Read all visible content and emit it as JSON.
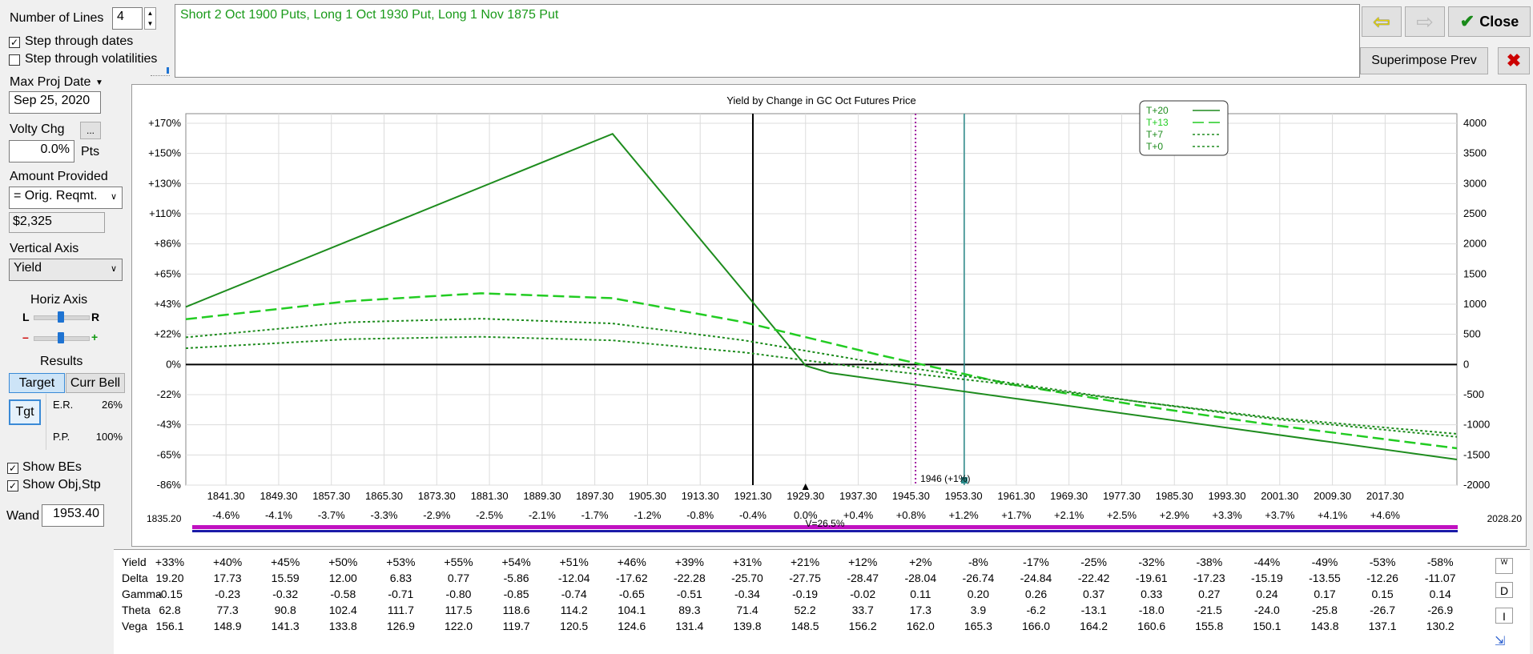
{
  "controls": {
    "lines_label": "Number of Lines",
    "lines_value": "4",
    "step_dates_label": "Step through dates",
    "step_dates_checked": true,
    "step_vols_label": "Step through volatilities",
    "step_vols_checked": false,
    "max_proj_label": "Max Proj Date",
    "max_proj_value": "Sep 25, 2020",
    "volty_label": "Volty Chg",
    "volty_btn": "...",
    "volty_value": "0.0%",
    "volty_unit": "Pts",
    "amount_label": "Amount Provided",
    "amount_select": "= Orig. Reqmt.",
    "amount_value": "$2,325",
    "vaxis_label": "Vertical Axis",
    "vaxis_select": "Yield",
    "haxis_label": "Horiz Axis",
    "haxis_l": "L",
    "haxis_r": "R",
    "haxis_minus": "–",
    "haxis_plus": "+",
    "results_label": "Results",
    "target_tab": "Target",
    "currbell_tab": "Curr Bell",
    "tgt_btn": "Tgt",
    "er_label": "E.R.",
    "er_value": "26%",
    "pp_label": "P.P.",
    "pp_value": "100%",
    "show_bes_label": "Show BEs",
    "show_bes_checked": true,
    "show_obj_label": "Show Obj,Stp",
    "show_obj_checked": true,
    "wand_label": "Wand",
    "wand_value": "1953.40"
  },
  "description": "Short 2 Oct 1900 Puts, Long 1 Oct 1930 Put, Long 1 Nov 1875 Put",
  "top_buttons": {
    "close": "Close",
    "superimpose": "Superimpose Prev"
  },
  "chart_data": {
    "type": "line",
    "title": "Yield by Change in GC Oct Futures Price",
    "x_ticks": [
      "1841.30",
      "1849.30",
      "1857.30",
      "1865.30",
      "1873.30",
      "1881.30",
      "1889.30",
      "1897.30",
      "1905.30",
      "1913.30",
      "1921.30",
      "1929.30",
      "1937.30",
      "1945.30",
      "1953.30",
      "1961.30",
      "1969.30",
      "1977.30",
      "1985.30",
      "1993.30",
      "2001.30",
      "2009.30",
      "2017.30"
    ],
    "x_pct_ticks": [
      "-4.6%",
      "-4.1%",
      "-3.7%",
      "-3.3%",
      "-2.9%",
      "-2.5%",
      "-2.1%",
      "-1.7%",
      "-1.2%",
      "-0.8%",
      "-0.4%",
      "0.0%",
      "+0.4%",
      "+0.8%",
      "+1.2%",
      "+1.7%",
      "+2.1%",
      "+2.5%",
      "+2.9%",
      "+3.3%",
      "+3.7%",
      "+4.1%",
      "+4.6%"
    ],
    "left_axis_ticks": [
      "+170%",
      "+150%",
      "+130%",
      "+110%",
      "+86%",
      "+65%",
      "+43%",
      "+22%",
      "0%",
      "-22%",
      "-43%",
      "-65%",
      "-86%"
    ],
    "right_axis_ticks": [
      "4000",
      "3500",
      "3000",
      "2500",
      "2000",
      "1500",
      "1000",
      "500",
      "0",
      "-500",
      "-1000",
      "-1500",
      "-2000"
    ],
    "x_range": [
      1835.2,
      2028.2
    ],
    "x_min_label": "1835.20",
    "x_max_label": "2028.20",
    "y_range": [
      -2000,
      4000
    ],
    "volatility_label": "V=26.5%",
    "current_price": 1929.3,
    "wand_price": 1953.4,
    "be_line_price": 1946,
    "be_annotation": "1946 (+1%)",
    "legend_position": "top-right",
    "series": [
      {
        "name": "T+20",
        "style": "solid",
        "color": "#1e8c1e",
        "x": [
          1835.2,
          1900,
          1929.3,
          1933,
          2028.2
        ],
        "y": [
          955,
          3825,
          -20,
          -140,
          -1575
        ]
      },
      {
        "name": "T+13",
        "style": "longdash",
        "color": "#22cc22",
        "x": [
          1835.2,
          1860,
          1880,
          1900,
          1920,
          1940,
          1960,
          1980,
          2000,
          2028.2
        ],
        "y": [
          750,
          1050,
          1180,
          1100,
          700,
          170,
          -320,
          -680,
          -1000,
          -1390
        ]
      },
      {
        "name": "T+7",
        "style": "dotted",
        "color": "#1e8c1e",
        "x": [
          1835.2,
          1860,
          1880,
          1900,
          1920,
          1940,
          1960,
          1980,
          2000,
          2028.2
        ],
        "y": [
          450,
          700,
          760,
          680,
          400,
          30,
          -300,
          -620,
          -900,
          -1200
        ]
      },
      {
        "name": "T+0",
        "style": "dotted",
        "color": "#1e8c1e",
        "x": [
          1835.2,
          1860,
          1880,
          1900,
          1920,
          1940,
          1960,
          1980,
          2000,
          2028.2
        ],
        "y": [
          270,
          420,
          460,
          400,
          200,
          -80,
          -330,
          -620,
          -880,
          -1150
        ]
      }
    ]
  },
  "table": {
    "row_labels": [
      "Yield",
      "Delta",
      "Gamma",
      "Theta",
      "Vega"
    ],
    "columns": [
      [
        "+33%",
        "19.20",
        "-0.15",
        "62.8",
        "156.1"
      ],
      [
        "+40%",
        "17.73",
        "-0.23",
        "77.3",
        "148.9"
      ],
      [
        "+45%",
        "15.59",
        "-0.32",
        "90.8",
        "141.3"
      ],
      [
        "+50%",
        "12.00",
        "-0.58",
        "102.4",
        "133.8"
      ],
      [
        "+53%",
        "6.83",
        "-0.71",
        "111.7",
        "126.9"
      ],
      [
        "+55%",
        "0.77",
        "-0.80",
        "117.5",
        "122.0"
      ],
      [
        "+54%",
        "-5.86",
        "-0.85",
        "118.6",
        "119.7"
      ],
      [
        "+51%",
        "-12.04",
        "-0.74",
        "114.2",
        "120.5"
      ],
      [
        "+46%",
        "-17.62",
        "-0.65",
        "104.1",
        "124.6"
      ],
      [
        "+39%",
        "-22.28",
        "-0.51",
        "89.3",
        "131.4"
      ],
      [
        "+31%",
        "-25.70",
        "-0.34",
        "71.4",
        "139.8"
      ],
      [
        "+21%",
        "-27.75",
        "-0.19",
        "52.2",
        "148.5"
      ],
      [
        "+12%",
        "-28.47",
        "-0.02",
        "33.7",
        "156.2"
      ],
      [
        "+2%",
        "-28.04",
        "0.11",
        "17.3",
        "162.0"
      ],
      [
        "-8%",
        "-26.74",
        "0.20",
        "3.9",
        "165.3"
      ],
      [
        "-17%",
        "-24.84",
        "0.26",
        "-6.2",
        "166.0"
      ],
      [
        "-25%",
        "-22.42",
        "0.37",
        "-13.1",
        "164.2"
      ],
      [
        "-32%",
        "-19.61",
        "0.33",
        "-18.0",
        "160.6"
      ],
      [
        "-38%",
        "-17.23",
        "0.27",
        "-21.5",
        "155.8"
      ],
      [
        "-44%",
        "-15.19",
        "0.24",
        "-24.0",
        "150.1"
      ],
      [
        "-49%",
        "-13.55",
        "0.17",
        "-25.8",
        "143.8"
      ],
      [
        "-53%",
        "-12.26",
        "0.15",
        "-26.7",
        "137.1"
      ],
      [
        "-58%",
        "-11.07",
        "0.14",
        "-26.9",
        "130.2"
      ]
    ],
    "side_buttons": [
      "W",
      "D",
      "I"
    ]
  }
}
